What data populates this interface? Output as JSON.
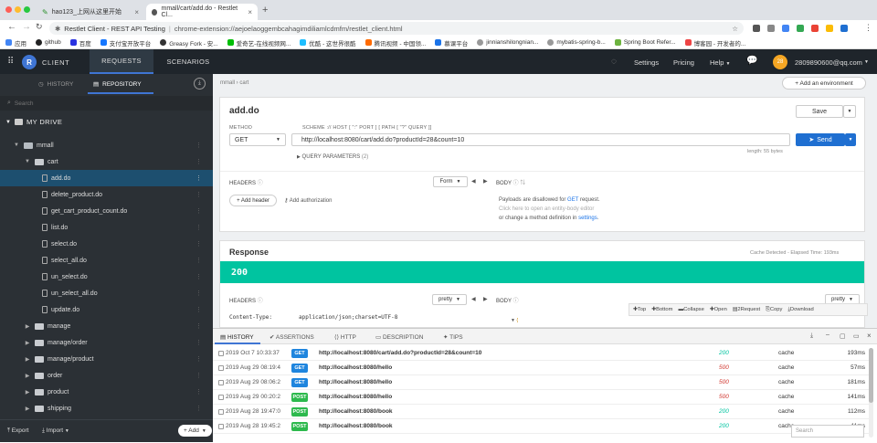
{
  "browser": {
    "tabs": [
      {
        "title": "hao123_上网从这里开始"
      },
      {
        "title": "mmall/cart/add.do - Restlet Cl..."
      }
    ],
    "new_tab": "+",
    "url_site": "Restlet Client - REST API Testing",
    "url_path": "chrome-extension://aejoelaoggembcahagimdiliamlcdmfm/restlet_client.html",
    "bookmarks": [
      "应用",
      "github",
      "百度",
      "支付宝开放平台",
      "Greasy Fork - 安...",
      "爱奇艺-在线视频网...",
      "优酷 - 这世界很酷",
      "腾讯视频 - 中国领...",
      "慕课平台",
      "jinnianshilongnian...",
      "mybatis-spring-b...",
      "Spring Boot Refer...",
      "博客园 - 开发者的..."
    ]
  },
  "app": {
    "brand_letter": "R",
    "brand_name": "CLIENT",
    "nav": [
      "REQUESTS",
      "SCENARIOS"
    ],
    "right_menu": [
      "Settings",
      "Pricing",
      "Help"
    ],
    "user_email": "2809890600@qq.com",
    "avatar_letter": "28"
  },
  "sidebar": {
    "tabs": [
      "HISTORY",
      "REPOSITORY"
    ],
    "search_placeholder": "Search",
    "drive_label": "MY DRIVE",
    "tree": [
      {
        "label": "mmall",
        "type": "project",
        "level": 1
      },
      {
        "label": "cart",
        "type": "folder",
        "level": 2
      },
      {
        "label": "add.do",
        "type": "request",
        "level": 3,
        "selected": true
      },
      {
        "label": "delete_product.do",
        "type": "request",
        "level": 3
      },
      {
        "label": "get_cart_product_count.do",
        "type": "request",
        "level": 3
      },
      {
        "label": "list.do",
        "type": "request",
        "level": 3
      },
      {
        "label": "select.do",
        "type": "request",
        "level": 3
      },
      {
        "label": "select_all.do",
        "type": "request",
        "level": 3
      },
      {
        "label": "un_select.do",
        "type": "request",
        "level": 3
      },
      {
        "label": "un_select_all.do",
        "type": "request",
        "level": 3
      },
      {
        "label": "update.do",
        "type": "request",
        "level": 3
      },
      {
        "label": "manage",
        "type": "folder",
        "level": 2
      },
      {
        "label": "manage/order",
        "type": "folder",
        "level": 2
      },
      {
        "label": "manage/product",
        "type": "folder",
        "level": 2
      },
      {
        "label": "order",
        "type": "folder",
        "level": 2
      },
      {
        "label": "product",
        "type": "folder",
        "level": 2
      },
      {
        "label": "shipping",
        "type": "folder",
        "level": 2
      }
    ],
    "footer": {
      "export": "Export",
      "import": "Import",
      "add": "+ Add"
    }
  },
  "request": {
    "breadcrumb": [
      "mmall",
      "cart"
    ],
    "add_env": "+ Add an environment",
    "name": "add.do",
    "save": "Save",
    "method_label": "METHOD",
    "method": "GET",
    "scheme_label": "SCHEME :// HOST [ \":\" PORT ] [ PATH [ \"?\" QUERY ]]",
    "url": "http://localhost:8080/cart/add.do?productId=28&count=10",
    "send": "Send",
    "length": "length: 55 bytes",
    "query_params": "QUERY PARAMETERS",
    "query_count": "(2)",
    "headers_label": "HEADERS",
    "form": "Form",
    "body_label": "BODY",
    "add_header": "+ Add header",
    "add_auth": "Add authorization",
    "body_msg1a": "Payloads are disallowed for ",
    "body_msg1b": "GET",
    "body_msg1c": " request.",
    "body_msg2": "Click here to open an entity-body editor",
    "body_msg3a": "or change a method definition in ",
    "body_msg3b": "settings",
    "body_msg3c": "."
  },
  "response": {
    "title": "Response",
    "elapsed": "Cache Detected - Elapsed Time: 193ms",
    "status": "200",
    "headers_label": "HEADERS",
    "pretty": "pretty",
    "body_label": "BODY",
    "content_type_key": "Content-Type:",
    "content_type_val": "application/json;charset=UTF-8",
    "toolbar": [
      "Top",
      "Bottom",
      "Collapse",
      "Open",
      "2Request",
      "Copy",
      "Download"
    ]
  },
  "history": {
    "tabs": [
      "HISTORY",
      "ASSERTIONS",
      "HTTP",
      "DESCRIPTION",
      "TIPS"
    ],
    "search_placeholder": "Search",
    "rows": [
      {
        "date": "2019 Oct 7 10:33:37",
        "method": "GET",
        "url": "http://localhost:8080/cart/add.do?productId=28&count=10",
        "status": "200",
        "cache": "cache",
        "time": "193ms"
      },
      {
        "date": "2019 Aug 29 08:19:4",
        "method": "GET",
        "url": "http://localhost:8080/hello",
        "status": "500",
        "cache": "cache",
        "time": "57ms"
      },
      {
        "date": "2019 Aug 29 08:06:2",
        "method": "GET",
        "url": "http://localhost:8080/hello",
        "status": "500",
        "cache": "cache",
        "time": "181ms"
      },
      {
        "date": "2019 Aug 29 00:20:2",
        "method": "POST",
        "url": "http://localhost:8080/hello",
        "status": "500",
        "cache": "cache",
        "time": "141ms"
      },
      {
        "date": "2019 Aug 28 19:47:0",
        "method": "POST",
        "url": "http://localhost:8080/book",
        "status": "200",
        "cache": "cache",
        "time": "112ms"
      },
      {
        "date": "2019 Aug 28 19:45:2",
        "method": "POST",
        "url": "http://localhost:8080/book",
        "status": "200",
        "cache": "cache",
        "time": "11ms"
      }
    ]
  },
  "colors": {
    "accent": "#1f6fd1",
    "status_ok": "#00c4a0",
    "status_err": "#d0342c",
    "get": "#1f85de",
    "post": "#2db94d",
    "sidebar": "#2b3035",
    "header": "#1f252b"
  }
}
